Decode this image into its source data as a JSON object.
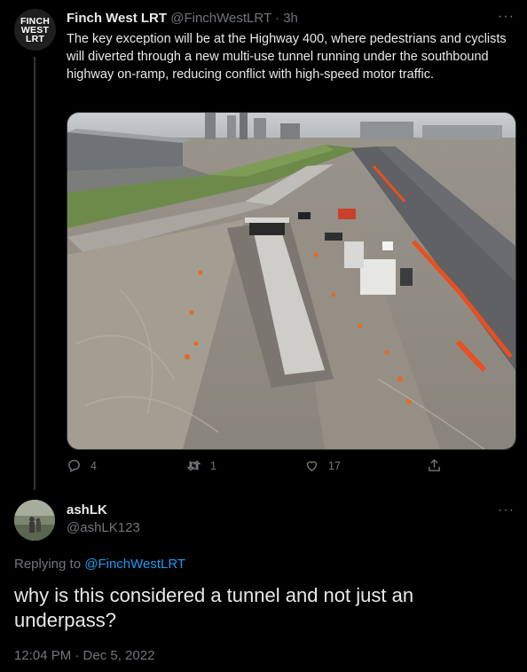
{
  "tweet": {
    "avatar_lines": [
      "FINCH",
      "WEST",
      "LRT"
    ],
    "name": "Finch West LRT",
    "handle": "@FinchWestLRT",
    "separator": "·",
    "time": "3h",
    "more": "···",
    "text": "The key exception will be at the Highway 400, where pedestrians and cyclists will diverted through a new multi-use tunnel running under the southbound highway on-ramp, reducing conflict with high-speed motor traffic.",
    "image_icon": "photo-construction-tunnel",
    "actions": {
      "reply_count": "4",
      "retweet_count": "1",
      "like_count": "17"
    }
  },
  "reply": {
    "name": "ashLK",
    "handle": "@ashLK123",
    "more": "···",
    "replying_prefix": "Replying to",
    "replying_to": "@FinchWestLRT",
    "text": "why is this considered a tunnel and not just an underpass?",
    "timestamp": "12:04 PM · Dec 5, 2022"
  },
  "colors": {
    "background": "#000000",
    "text": "#e7e9ea",
    "muted": "#71767b",
    "link": "#1d9bf0"
  }
}
